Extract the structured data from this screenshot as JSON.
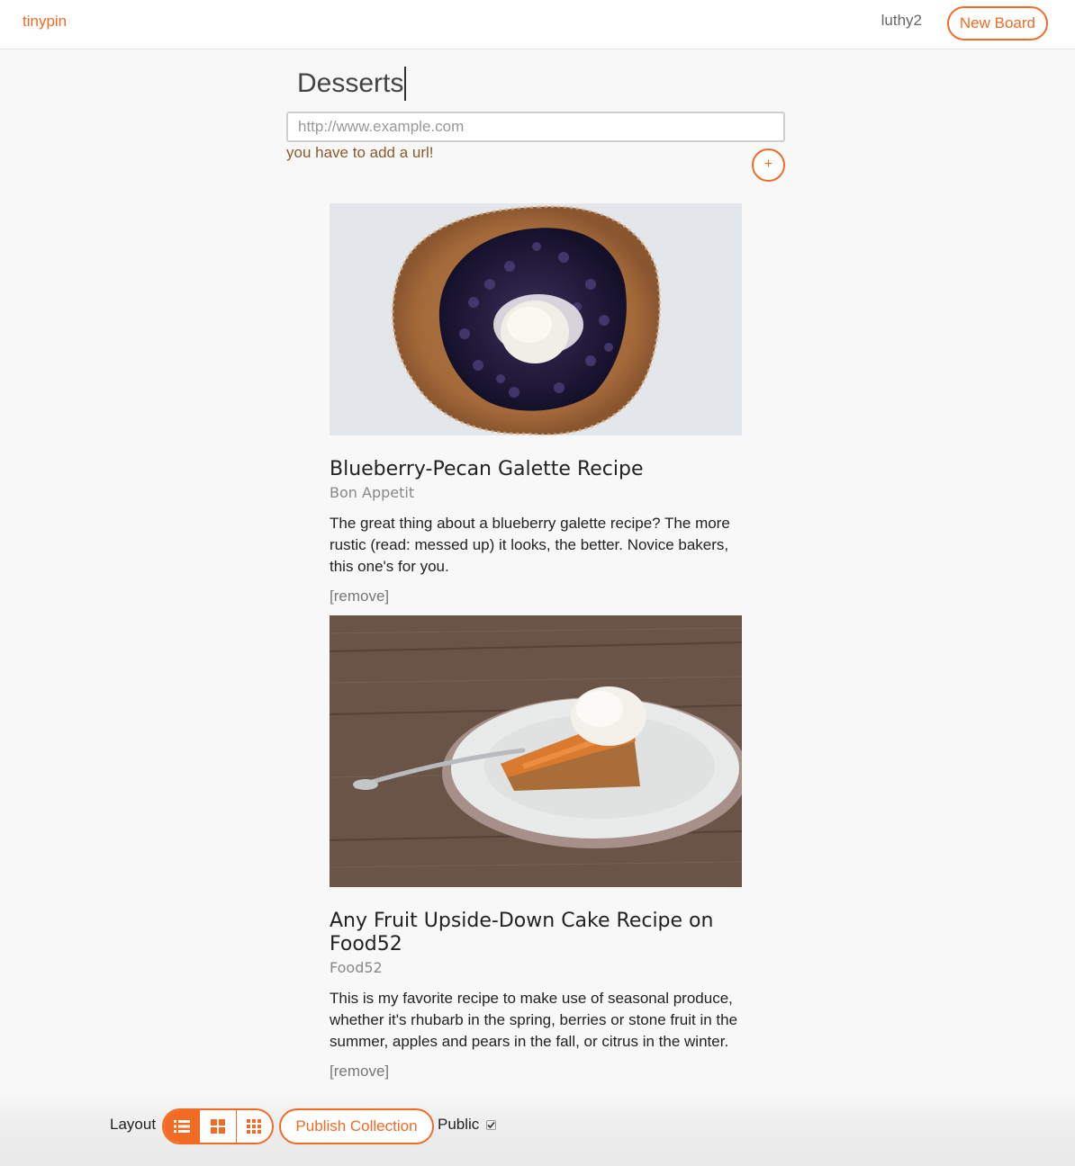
{
  "header": {
    "brand": "tinypin",
    "username": "luthy2",
    "new_board_label": "New Board"
  },
  "board": {
    "title": "Desserts",
    "url_placeholder": "http://www.example.com",
    "error": "you have to add a url!",
    "add_label": "+"
  },
  "pins": [
    {
      "title": "Blueberry-Pecan Galette Recipe",
      "source": "Bon Appetit",
      "description": "The great thing about a blueberry galette recipe? The more rustic (read: messed up) it looks, the better. Novice bakers, this one's for you.",
      "remove_label": "[remove]"
    },
    {
      "title": "Any Fruit Upside-Down Cake Recipe on Food52",
      "source": "Food52",
      "description": "This is my favorite recipe to make use of seasonal produce, whether it's rhubarb in the spring, berries or stone fruit in the summer, apples and pears in the fall, or citrus in the winter.",
      "remove_label": "[remove]"
    }
  ],
  "footer": {
    "layout_label": "Layout",
    "layout_options": [
      "list-icon",
      "grid-2x2-icon",
      "grid-3x3-icon"
    ],
    "active_layout": "list-icon",
    "publish_label": "Publish Collection",
    "public_label": "Public",
    "public_checked": true
  },
  "colors": {
    "accent": "#f26b24",
    "background": "#f8f8f8",
    "error_text": "#8a5a2b"
  }
}
